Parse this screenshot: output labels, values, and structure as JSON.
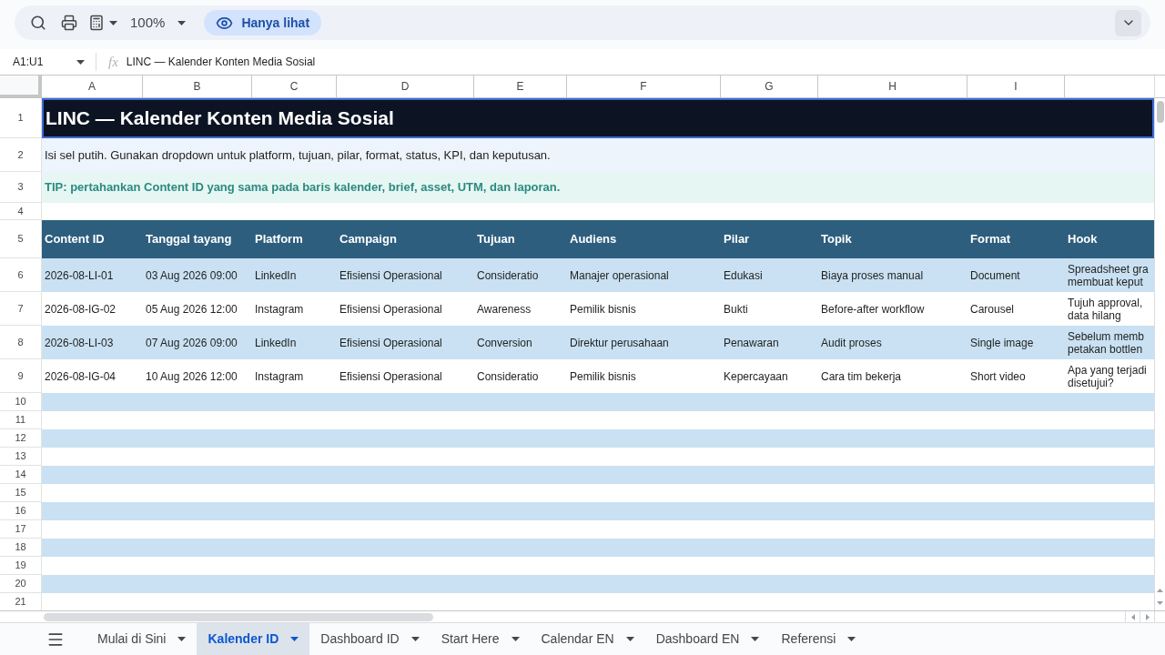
{
  "toolbar": {
    "zoom": "100%",
    "view_mode": "Hanya lihat"
  },
  "formula_bar": {
    "name_box": "A1:U1",
    "function_label": "fx",
    "content": "LINC — Kalender Konten Media Sosial"
  },
  "sheet": {
    "column_letters": [
      "A",
      "B",
      "C",
      "D",
      "E",
      "F",
      "G",
      "H",
      "I"
    ],
    "row_numbers": [
      "1",
      "2",
      "3",
      "4",
      "5",
      "6",
      "7",
      "8",
      "9",
      "10",
      "11",
      "12",
      "13",
      "14",
      "15",
      "16",
      "17",
      "18",
      "19",
      "20",
      "21"
    ],
    "title": "LINC — Kalender Konten Media Sosial",
    "instruction": "Isi sel putih. Gunakan dropdown untuk platform, tujuan, pilar, format, status, KPI, dan keputusan.",
    "tip": "TIP: pertahankan Content ID yang sama pada baris kalender, brief, asset, UTM, dan laporan.",
    "table": {
      "columns": [
        "Content ID",
        "Tanggal tayang",
        "Platform",
        "Campaign",
        "Tujuan",
        "Audiens",
        "Pilar",
        "Topik",
        "Format",
        "Hook"
      ],
      "rows": [
        [
          "2026-08-LI-01",
          "03 Aug 2026 09:00",
          "LinkedIn",
          "Efisiensi Operasional",
          "Consideratio",
          "Manajer operasional",
          "Edukasi",
          "Biaya proses manual",
          "Document",
          "Spreadsheet gra\nmembuat keput"
        ],
        [
          "2026-08-IG-02",
          "05 Aug 2026 12:00",
          "Instagram",
          "Efisiensi Operasional",
          "Awareness",
          "Pemilik bisnis",
          "Bukti",
          "Before-after workflow",
          "Carousel",
          "Tujuh approval,\ndata hilang"
        ],
        [
          "2026-08-LI-03",
          "07 Aug 2026 09:00",
          "LinkedIn",
          "Efisiensi Operasional",
          "Conversion",
          "Direktur perusahaan",
          "Penawaran",
          "Audit proses",
          "Single image",
          "Sebelum memb\npetakan bottlen"
        ],
        [
          "2026-08-IG-04",
          "10 Aug 2026 12:00",
          "Instagram",
          "Efisiensi Operasional",
          "Consideratio",
          "Pemilik bisnis",
          "Kepercayaan",
          "Cara tim bekerja",
          "Short video",
          "Apa yang terjadi\ndisetujui?"
        ]
      ]
    }
  },
  "sheet_tabs": [
    {
      "label": "Mulai di Sini",
      "selected": false
    },
    {
      "label": "Kalender ID",
      "selected": true
    },
    {
      "label": "Dashboard ID",
      "selected": false
    },
    {
      "label": "Start Here",
      "selected": false
    },
    {
      "label": "Calendar EN",
      "selected": false
    },
    {
      "label": "Dashboard EN",
      "selected": false
    },
    {
      "label": "Referensi",
      "selected": false
    }
  ]
}
